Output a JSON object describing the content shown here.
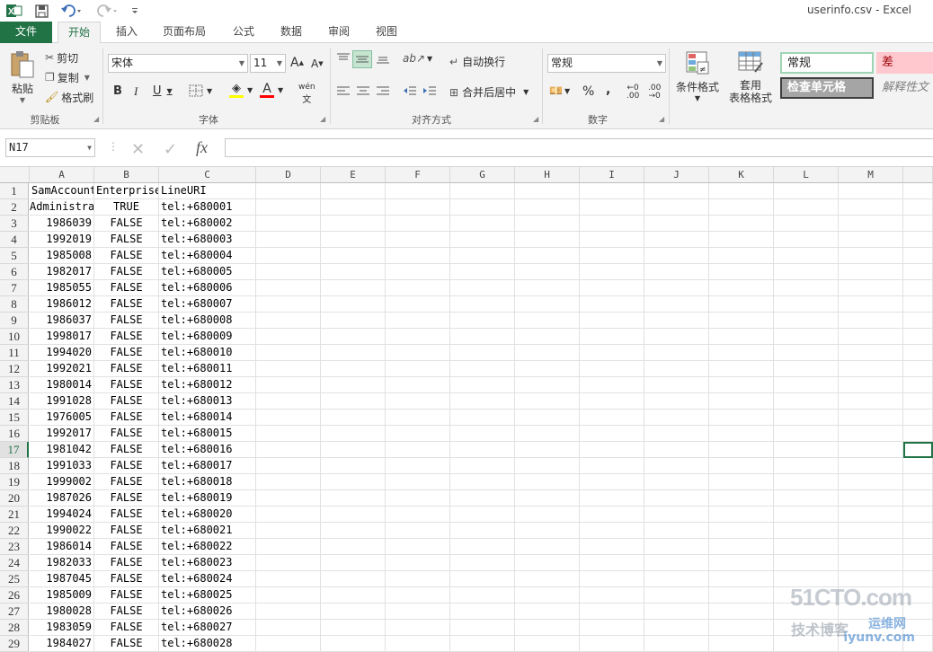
{
  "app": {
    "title": "userinfo.csv - Excel"
  },
  "qat": {
    "excel_icon": "excel-logo-icon",
    "save_icon": "save-icon",
    "undo_icon": "undo-icon",
    "redo_icon": "redo-icon",
    "customize_icon": "customize-icon"
  },
  "tabs": [
    {
      "label": "文件"
    },
    {
      "label": "开始"
    },
    {
      "label": "插入"
    },
    {
      "label": "页面布局"
    },
    {
      "label": "公式"
    },
    {
      "label": "数据"
    },
    {
      "label": "审阅"
    },
    {
      "label": "视图"
    }
  ],
  "ribbon": {
    "clipboard": {
      "group": "剪贴板",
      "paste": "粘贴",
      "cut": "剪切",
      "copy": "复制",
      "format_painter": "格式刷"
    },
    "font": {
      "group": "字体",
      "name": "宋体",
      "size": "11",
      "bold": "B",
      "italic": "I",
      "underline": "U",
      "grow": "A",
      "shrink": "A",
      "phonetic": "wén",
      "fill_color": "#ffff00",
      "font_color": "#ff0000"
    },
    "alignment": {
      "group": "对齐方式",
      "wrap": "自动换行",
      "merge": "合并后居中"
    },
    "number": {
      "group": "数字",
      "format": "常规",
      "percent": "%",
      "comma": ",",
      "inc_decimal": ".00",
      "dec_decimal": ".00"
    },
    "styles": {
      "conditional": "条件格式",
      "table_line1": "套用",
      "table_line2": "表格格式",
      "normal": "常规",
      "bad": "差",
      "check": "检查单元格",
      "explanatory": "解释性文"
    }
  },
  "formula_bar": {
    "name_box": "N17",
    "cancel": "✕",
    "enter": "✓",
    "fx": "fx",
    "value": ""
  },
  "columns": [
    "A",
    "B",
    "C",
    "D",
    "E",
    "F",
    "G",
    "H",
    "I",
    "J",
    "K",
    "L",
    "M"
  ],
  "rows": [
    {
      "n": "1",
      "a": "SamAccountName",
      "b": "EnterpriseVoiceEnabled",
      "c": "LineURI"
    },
    {
      "n": "2",
      "a": "Administrator",
      "b": "TRUE",
      "c": "tel:+680001"
    },
    {
      "n": "3",
      "a": "1986039",
      "b": "FALSE",
      "c": "tel:+680002"
    },
    {
      "n": "4",
      "a": "1992019",
      "b": "FALSE",
      "c": "tel:+680003"
    },
    {
      "n": "5",
      "a": "1985008",
      "b": "FALSE",
      "c": "tel:+680004"
    },
    {
      "n": "6",
      "a": "1982017",
      "b": "FALSE",
      "c": "tel:+680005"
    },
    {
      "n": "7",
      "a": "1985055",
      "b": "FALSE",
      "c": "tel:+680006"
    },
    {
      "n": "8",
      "a": "1986012",
      "b": "FALSE",
      "c": "tel:+680007"
    },
    {
      "n": "9",
      "a": "1986037",
      "b": "FALSE",
      "c": "tel:+680008"
    },
    {
      "n": "10",
      "a": "1998017",
      "b": "FALSE",
      "c": "tel:+680009"
    },
    {
      "n": "11",
      "a": "1994020",
      "b": "FALSE",
      "c": "tel:+680010"
    },
    {
      "n": "12",
      "a": "1992021",
      "b": "FALSE",
      "c": "tel:+680011"
    },
    {
      "n": "13",
      "a": "1980014",
      "b": "FALSE",
      "c": "tel:+680012"
    },
    {
      "n": "14",
      "a": "1991028",
      "b": "FALSE",
      "c": "tel:+680013"
    },
    {
      "n": "15",
      "a": "1976005",
      "b": "FALSE",
      "c": "tel:+680014"
    },
    {
      "n": "16",
      "a": "1992017",
      "b": "FALSE",
      "c": "tel:+680015"
    },
    {
      "n": "17",
      "a": "1981042",
      "b": "FALSE",
      "c": "tel:+680016"
    },
    {
      "n": "18",
      "a": "1991033",
      "b": "FALSE",
      "c": "tel:+680017"
    },
    {
      "n": "19",
      "a": "1999002",
      "b": "FALSE",
      "c": "tel:+680018"
    },
    {
      "n": "20",
      "a": "1987026",
      "b": "FALSE",
      "c": "tel:+680019"
    },
    {
      "n": "21",
      "a": "1994024",
      "b": "FALSE",
      "c": "tel:+680020"
    },
    {
      "n": "22",
      "a": "1990022",
      "b": "FALSE",
      "c": "tel:+680021"
    },
    {
      "n": "23",
      "a": "1986014",
      "b": "FALSE",
      "c": "tel:+680022"
    },
    {
      "n": "24",
      "a": "1982033",
      "b": "FALSE",
      "c": "tel:+680023"
    },
    {
      "n": "25",
      "a": "1987045",
      "b": "FALSE",
      "c": "tel:+680024"
    },
    {
      "n": "26",
      "a": "1985009",
      "b": "FALSE",
      "c": "tel:+680025"
    },
    {
      "n": "27",
      "a": "1980028",
      "b": "FALSE",
      "c": "tel:+680026"
    },
    {
      "n": "28",
      "a": "1983059",
      "b": "FALSE",
      "c": "tel:+680027"
    },
    {
      "n": "29",
      "a": "1984027",
      "b": "FALSE",
      "c": "tel:+680028"
    }
  ],
  "selected_row": "17",
  "watermark": {
    "line1": "51CTO.com",
    "line2": "技术博客",
    "line3": "运维网",
    "line4": "iyunv.com"
  },
  "colors": {
    "accent": "#217346",
    "bad_fill": "#ffc7ce",
    "bad_text": "#9c0006",
    "check_fill": "#a5a5a5"
  }
}
